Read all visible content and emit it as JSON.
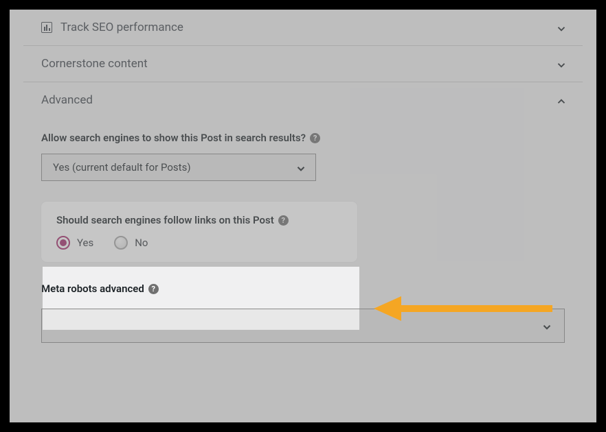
{
  "panels": {
    "track": "Track SEO performance",
    "cornerstone": "Cornerstone content",
    "advanced": "Advanced"
  },
  "advanced": {
    "allow_label": "Allow search engines to show this Post in search results?",
    "allow_value": "Yes (current default for Posts)",
    "follow_label": "Should search engines follow links on this Post",
    "yes": "Yes",
    "no": "No",
    "meta_label": "Meta robots advanced"
  }
}
